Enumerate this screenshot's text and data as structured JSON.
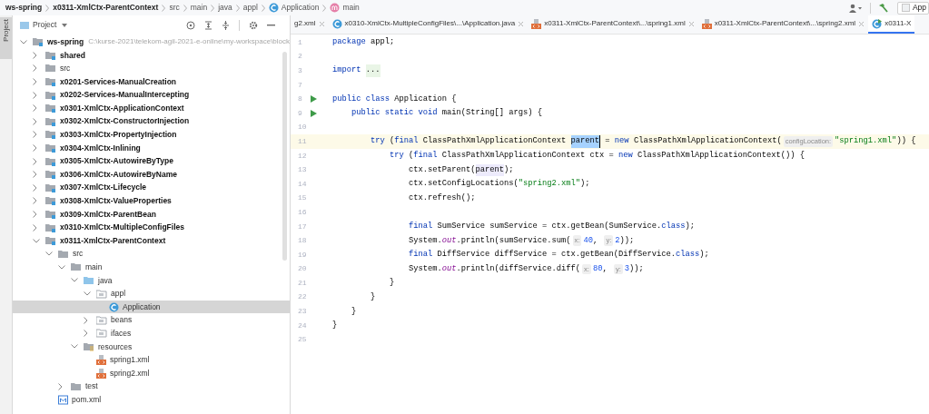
{
  "breadcrumb": {
    "items": [
      {
        "text": "ws-spring",
        "kind": "project"
      },
      {
        "text": "x0311-XmlCtx-ParentContext",
        "kind": "module"
      },
      {
        "text": "src",
        "kind": "folder"
      },
      {
        "text": "main",
        "kind": "folder"
      },
      {
        "text": "java",
        "kind": "folder"
      },
      {
        "text": "appl",
        "kind": "folder"
      },
      {
        "text": "Application",
        "kind": "class"
      },
      {
        "text": "main",
        "kind": "method"
      }
    ],
    "run_config": "App"
  },
  "tool_stripe": {
    "tab": "Project",
    "selected": true
  },
  "project_panel": {
    "title": "Project",
    "tree": [
      {
        "label": "ws-spring",
        "path": "C:\\kurse-2021\\telekom-agil-2021-e-online\\my-workspace\\block",
        "kind": "project",
        "expanded": true,
        "selected": false,
        "children": [
          {
            "label": "shared",
            "kind": "module",
            "expanded": false,
            "selected": false
          },
          {
            "label": "src",
            "kind": "folder",
            "expanded": false,
            "selected": false
          },
          {
            "label": "x0201-Services-ManualCreation",
            "kind": "module",
            "expanded": false,
            "selected": false
          },
          {
            "label": "x0202-Services-ManualIntercepting",
            "kind": "module",
            "expanded": false,
            "selected": false
          },
          {
            "label": "x0301-XmlCtx-ApplicationContext",
            "kind": "module",
            "expanded": false,
            "selected": false
          },
          {
            "label": "x0302-XmlCtx-ConstructorInjection",
            "kind": "module",
            "expanded": false,
            "selected": false
          },
          {
            "label": "x0303-XmlCtx-PropertyInjection",
            "kind": "module",
            "expanded": false,
            "selected": false
          },
          {
            "label": "x0304-XmlCtx-Inlining",
            "kind": "module",
            "expanded": false,
            "selected": false
          },
          {
            "label": "x0305-XmlCtx-AutowireByType",
            "kind": "module",
            "expanded": false,
            "selected": false
          },
          {
            "label": "x0306-XmlCtx-AutowireByName",
            "kind": "module",
            "expanded": false,
            "selected": false
          },
          {
            "label": "x0307-XmlCtx-Lifecycle",
            "kind": "module",
            "expanded": false,
            "selected": false
          },
          {
            "label": "x0308-XmlCtx-ValueProperties",
            "kind": "module",
            "expanded": false,
            "selected": false
          },
          {
            "label": "x0309-XmlCtx-ParentBean",
            "kind": "module",
            "expanded": false,
            "selected": false
          },
          {
            "label": "x0310-XmlCtx-MultipleConfigFiles",
            "kind": "module",
            "expanded": false,
            "selected": false
          },
          {
            "label": "x0311-XmlCtx-ParentContext",
            "kind": "module",
            "expanded": true,
            "selected": false,
            "children": [
              {
                "label": "src",
                "kind": "folder",
                "expanded": true,
                "selected": false,
                "children": [
                  {
                    "label": "main",
                    "kind": "folder",
                    "expanded": true,
                    "selected": false,
                    "children": [
                      {
                        "label": "java",
                        "kind": "source-folder",
                        "expanded": true,
                        "selected": false,
                        "children": [
                          {
                            "label": "appl",
                            "kind": "package",
                            "expanded": true,
                            "selected": false,
                            "children": [
                              {
                                "label": "Application",
                                "kind": "class",
                                "selected": true
                              }
                            ]
                          },
                          {
                            "label": "beans",
                            "kind": "package",
                            "expanded": false,
                            "selected": false
                          },
                          {
                            "label": "ifaces",
                            "kind": "package",
                            "expanded": false,
                            "selected": false
                          }
                        ]
                      },
                      {
                        "label": "resources",
                        "kind": "resources-folder",
                        "expanded": true,
                        "selected": false,
                        "children": [
                          {
                            "label": "spring1.xml",
                            "kind": "xml",
                            "selected": false
                          },
                          {
                            "label": "spring2.xml",
                            "kind": "xml",
                            "selected": false
                          }
                        ]
                      }
                    ]
                  },
                  {
                    "label": "test",
                    "kind": "folder",
                    "expanded": false,
                    "selected": false
                  }
                ]
              },
              {
                "label": "pom.xml",
                "kind": "pom",
                "selected": false
              }
            ]
          }
        ]
      }
    ]
  },
  "editor_tabs": [
    {
      "label": "g2.xml",
      "selected": false
    },
    {
      "label": "x0310-XmlCtx-MultipleConfigFiles\\...\\Application.java",
      "kind": "class",
      "selected": false
    },
    {
      "label": "x0311-XmlCtx-ParentContext\\...\\spring1.xml",
      "kind": "xml",
      "selected": false
    },
    {
      "label": "x0311-XmlCtx-ParentContext\\...\\spring2.xml",
      "kind": "xml",
      "selected": false
    },
    {
      "label": "x0311-X",
      "kind": "class-run",
      "selected": true
    }
  ],
  "code": {
    "lines": [
      {
        "number": "1",
        "current": false,
        "runnable": false,
        "tokens": [
          {
            "kind": "keyword",
            "text": "package"
          },
          {
            "kind": "plain",
            "text": " appl;"
          }
        ]
      },
      {
        "number": "2",
        "current": false,
        "runnable": false
      },
      {
        "number": "3",
        "current": false,
        "runnable": false,
        "tokens": [
          {
            "kind": "keyword",
            "text": "import "
          },
          {
            "kind": "folded",
            "text": "..."
          }
        ]
      },
      {
        "number": "7",
        "current": false,
        "runnable": false
      },
      {
        "number": "8",
        "current": false,
        "runnable": true,
        "tokens": [
          {
            "kind": "keyword",
            "text": "public class"
          },
          {
            "kind": "plain",
            "text": " Application {"
          }
        ]
      },
      {
        "number": "9",
        "current": false,
        "runnable": true,
        "tokens": [
          {
            "kind": "keyword",
            "text": "    public static void"
          },
          {
            "kind": "plain",
            "text": " main(String[] args) {"
          }
        ]
      },
      {
        "number": "10",
        "current": false,
        "runnable": false
      },
      {
        "number": "11",
        "current": true,
        "runnable": false,
        "tokens": [
          {
            "kind": "keyword",
            "text": "        try"
          },
          {
            "kind": "plain",
            "text": " ("
          },
          {
            "kind": "keyword",
            "text": "final"
          },
          {
            "kind": "plain",
            "text": " ClassPathXmlApplicationContext "
          },
          {
            "kind": "selection",
            "text": "parent"
          },
          {
            "kind": "plain",
            "text": " = "
          },
          {
            "kind": "keyword",
            "text": "new"
          },
          {
            "kind": "plain",
            "text": " ClassPathXmlApplicationContext("
          },
          {
            "kind": "hint",
            "text": "configLocation:"
          },
          {
            "kind": "string",
            "text": "\"spring1.xml\""
          },
          {
            "kind": "plain",
            "text": ")) {"
          }
        ]
      },
      {
        "number": "12",
        "current": false,
        "runnable": false,
        "tokens": [
          {
            "kind": "keyword",
            "text": "            try"
          },
          {
            "kind": "plain",
            "text": " ("
          },
          {
            "kind": "keyword",
            "text": "final"
          },
          {
            "kind": "plain",
            "text": " ClassPathXmlApplicationContext ctx = "
          },
          {
            "kind": "keyword",
            "text": "new"
          },
          {
            "kind": "plain",
            "text": " ClassPathXmlApplicationContext()) {"
          }
        ]
      },
      {
        "number": "13",
        "current": false,
        "runnable": false,
        "tokens": [
          {
            "kind": "plain",
            "text": "                ctx.setParent("
          },
          {
            "kind": "usage",
            "text": "parent"
          },
          {
            "kind": "plain",
            "text": ");"
          }
        ]
      },
      {
        "number": "14",
        "current": false,
        "runnable": false,
        "tokens": [
          {
            "kind": "plain",
            "text": "                ctx.setConfigLocations("
          },
          {
            "kind": "string",
            "text": "\"spring2.xml\""
          },
          {
            "kind": "plain",
            "text": ");"
          }
        ]
      },
      {
        "number": "15",
        "current": false,
        "runnable": false,
        "tokens": [
          {
            "kind": "plain",
            "text": "                ctx.refresh();"
          }
        ]
      },
      {
        "number": "16",
        "current": false,
        "runnable": false
      },
      {
        "number": "17",
        "current": false,
        "runnable": false,
        "tokens": [
          {
            "kind": "keyword",
            "text": "                final"
          },
          {
            "kind": "plain",
            "text": " SumService sumService = ctx.getBean(SumService."
          },
          {
            "kind": "keyword",
            "text": "class"
          },
          {
            "kind": "plain",
            "text": ");"
          }
        ]
      },
      {
        "number": "18",
        "current": false,
        "runnable": false,
        "tokens": [
          {
            "kind": "plain",
            "text": "                System."
          },
          {
            "kind": "field",
            "text": "out"
          },
          {
            "kind": "plain",
            "text": ".println(sumService.sum("
          },
          {
            "kind": "hint",
            "text": "x:"
          },
          {
            "kind": "number",
            "text": "40"
          },
          {
            "kind": "plain",
            "text": ", "
          },
          {
            "kind": "hint",
            "text": "y:"
          },
          {
            "kind": "number",
            "text": "2"
          },
          {
            "kind": "plain",
            "text": "));"
          }
        ]
      },
      {
        "number": "19",
        "current": false,
        "runnable": false,
        "tokens": [
          {
            "kind": "keyword",
            "text": "                final"
          },
          {
            "kind": "plain",
            "text": " DiffService diffService = ctx.getBean(DiffService."
          },
          {
            "kind": "keyword",
            "text": "class"
          },
          {
            "kind": "plain",
            "text": ");"
          }
        ]
      },
      {
        "number": "20",
        "current": false,
        "runnable": false,
        "tokens": [
          {
            "kind": "plain",
            "text": "                System."
          },
          {
            "kind": "field",
            "text": "out"
          },
          {
            "kind": "plain",
            "text": ".println(diffService.diff("
          },
          {
            "kind": "hint",
            "text": "x:"
          },
          {
            "kind": "number",
            "text": "80"
          },
          {
            "kind": "plain",
            "text": ", "
          },
          {
            "kind": "hint",
            "text": "y:"
          },
          {
            "kind": "number",
            "text": "3"
          },
          {
            "kind": "plain",
            "text": "));"
          }
        ]
      },
      {
        "number": "21",
        "current": false,
        "runnable": false,
        "tokens": [
          {
            "kind": "plain",
            "text": "            }"
          }
        ]
      },
      {
        "number": "22",
        "current": false,
        "runnable": false,
        "tokens": [
          {
            "kind": "plain",
            "text": "        }"
          }
        ]
      },
      {
        "number": "23",
        "current": false,
        "runnable": false,
        "tokens": [
          {
            "kind": "plain",
            "text": "    }"
          }
        ]
      },
      {
        "number": "24",
        "current": false,
        "runnable": false,
        "tokens": [
          {
            "kind": "plain",
            "text": "}"
          }
        ]
      },
      {
        "number": "25",
        "current": false,
        "runnable": false
      }
    ]
  }
}
